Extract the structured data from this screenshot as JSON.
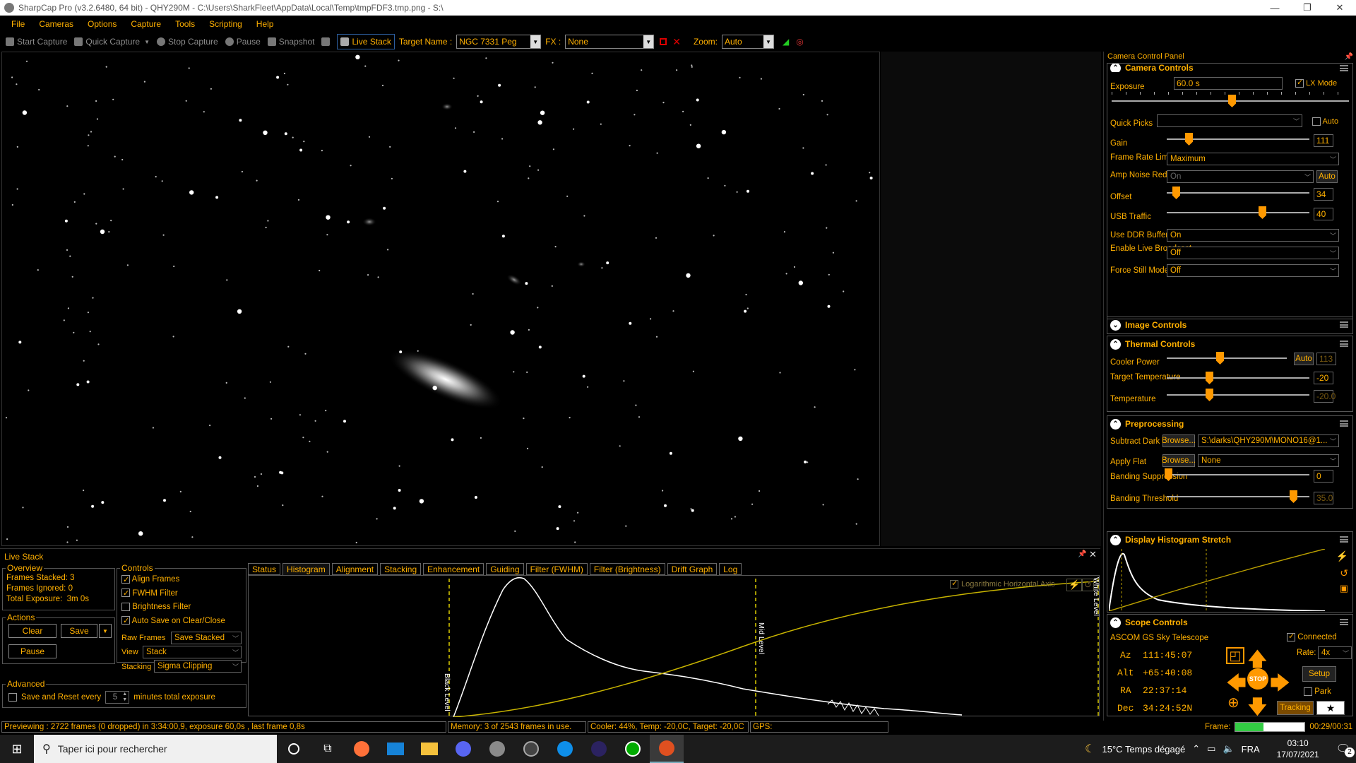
{
  "window": {
    "title": "SharpCap Pro (v3.2.6480, 64 bit) - QHY290M - C:\\Users\\SharkFleet\\AppData\\Local\\Temp\\tmpFDF3.tmp.png - S:\\",
    "minimize": "—",
    "maximize": "❐",
    "close": "✕"
  },
  "menu": [
    "File",
    "Cameras",
    "Options",
    "Capture",
    "Tools",
    "Scripting",
    "Help"
  ],
  "toolbar": {
    "start_capture": "Start Capture",
    "quick_capture": "Quick Capture",
    "stop_capture": "Stop Capture",
    "pause": "Pause",
    "snapshot": "Snapshot",
    "live_stack": "Live Stack",
    "target_label": "Target Name :",
    "target_value": "NGC 7331 Peg",
    "fx_label": "FX :",
    "fx_value": "None",
    "zoom_label": "Zoom:",
    "zoom_value": "Auto"
  },
  "panel": {
    "title": "Camera Control Panel",
    "camera_controls": {
      "header": "Camera Controls",
      "exposure_label": "Exposure",
      "exposure_value": "60.0 s",
      "lx_mode_label": "LX Mode",
      "lx_mode": true,
      "quick_picks_label": "Quick Picks",
      "quick_picks_value": "",
      "auto_label": "Auto",
      "gain_label": "Gain",
      "gain_value": "111",
      "frame_rate_label": "Frame Rate Limit",
      "frame_rate_value": "Maximum",
      "amp_noise_label": "Amp Noise Reduction",
      "amp_noise_value": "On",
      "amp_auto": "Auto",
      "offset_label": "Offset",
      "offset_value": "34",
      "usb_label": "USB Traffic",
      "usb_value": "40",
      "ddr_label": "Use DDR Buffer",
      "ddr_value": "On",
      "live_broadcast_label": "Enable Live Broadcast",
      "live_broadcast_value": "Off",
      "force_still_label": "Force Still Mode",
      "force_still_value": "Off"
    },
    "image_controls": {
      "header": "Image Controls"
    },
    "thermal": {
      "header": "Thermal Controls",
      "cooler_label": "Cooler Power",
      "cooler_auto": "Auto",
      "cooler_value": "113",
      "target_temp_label": "Target Temperature",
      "target_temp_value": "-20",
      "temp_label": "Temperature",
      "temp_value": "-20.0"
    },
    "preprocessing": {
      "header": "Preprocessing",
      "subtract_dark_label": "Subtract Dark",
      "browse": "Browse...",
      "dark_value": "S:\\darks\\QHY290M\\MONO16@1...",
      "apply_flat_label": "Apply Flat",
      "flat_value": "None",
      "banding_supp_label": "Banding Suppression",
      "banding_supp_value": "0",
      "banding_thr_label": "Banding Threshold",
      "banding_thr_value": "35.0"
    },
    "histogram_stretch": {
      "header": "Display Histogram Stretch"
    },
    "scope": {
      "header": "Scope Controls",
      "telescope": "ASCOM GS Sky Telescope",
      "connected_label": "Connected",
      "connected": true,
      "az_label": "Az",
      "az_value": "111:45:07",
      "alt_label": "Alt",
      "alt_value": "+65:40:08",
      "ra_label": "RA",
      "ra_value": "22:37:14",
      "dec_label": "Dec",
      "dec_value": "34:24:52N",
      "rate_label": "Rate:",
      "rate_value": "4x",
      "setup": "Setup",
      "park": "Park",
      "stop": "STOP",
      "tracking": "Tracking"
    }
  },
  "livestack": {
    "title": "Live Stack",
    "overview": {
      "title": "Overview",
      "frames_stacked_label": "Frames Stacked:",
      "frames_stacked": "3",
      "frames_ignored_label": "Frames Ignored:",
      "frames_ignored": "0",
      "total_exposure_label": "Total Exposure:",
      "total_exposure": "3m 0s"
    },
    "actions": {
      "title": "Actions",
      "clear": "Clear",
      "save": "Save",
      "pause": "Pause"
    },
    "advanced": {
      "title": "Advanced",
      "save_reset_label": "Save and Reset every",
      "save_reset_value": "5",
      "minutes_label": "minutes total exposure"
    },
    "controls": {
      "title": "Controls",
      "align_frames": "Align Frames",
      "fwhm_filter": "FWHM Filter",
      "brightness_filter": "Brightness Filter",
      "auto_save": "Auto Save on Clear/Close",
      "raw_frames_label": "Raw Frames",
      "raw_frames_value": "Save Stacked",
      "view_label": "View",
      "view_value": "Stack",
      "stacking_label": "Stacking",
      "stacking_value": "Sigma Clipping"
    },
    "tabs": [
      "Status",
      "Histogram",
      "Alignment",
      "Stacking",
      "Enhancement",
      "Guiding",
      "Filter (FWHM)",
      "Filter (Brightness)",
      "Drift Graph",
      "Log"
    ],
    "selected_tab": "Histogram",
    "histogram": {
      "log_axis_label": "Logarithmic Horizontal Axis",
      "black_level": "Black Level",
      "mid_level": "Mid Level",
      "white_level": "White Level"
    }
  },
  "status": {
    "previewing": "Previewing : 2722 frames (0 dropped) in 3:34:00,9, exposure 60,0s , last frame 0,8s",
    "memory": "Memory: 3 of 2543 frames in use.",
    "cooler": "Cooler: 44%, Temp: -20,0C, Target: -20,0C",
    "gps": "GPS:",
    "frame_label": "Frame:",
    "frame_time": "00:29/00:31",
    "frame_progress": 0.4
  },
  "taskbar": {
    "search_placeholder": "Taper ici pour rechercher",
    "weather": "15°C  Temps dégagé",
    "lang": "FRA",
    "time": "03:10",
    "date": "17/07/2021",
    "notif_count": "2"
  }
}
